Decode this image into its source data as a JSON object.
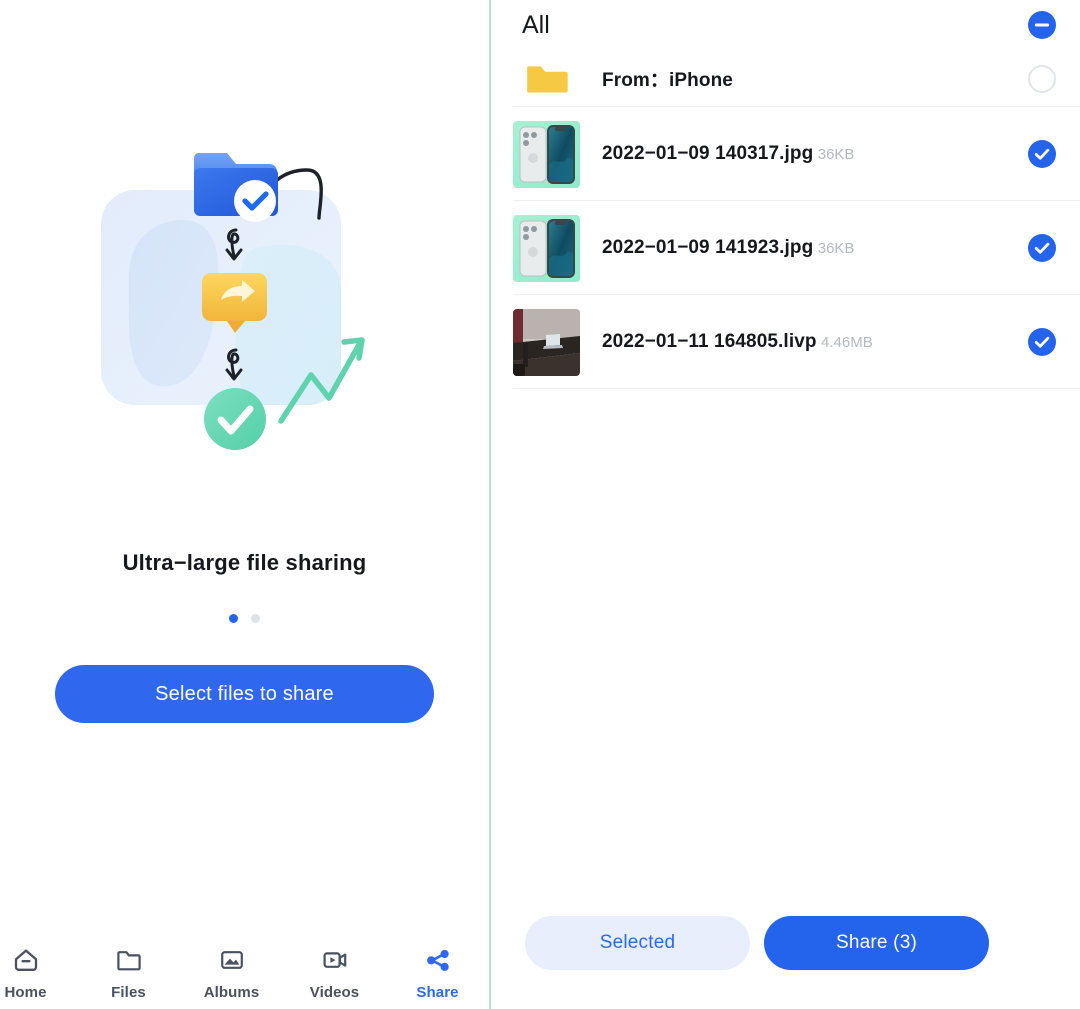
{
  "theme": {
    "accent_blue": "#2463eb",
    "cta_blue": "#2f68ef",
    "soft_blue_bg": "#e9eefc",
    "divider_blue": "#bcd9e8",
    "text_primary": "#16181c",
    "text_muted": "#b3b8c2",
    "nav_inactive": "#4a5160",
    "folder_yellow": "#f5c944"
  },
  "left": {
    "hero": {
      "icon": "ultra-large-file-sharing-illustration",
      "title": "Ultra−large file sharing"
    },
    "carousel": {
      "total": 2,
      "active_index": 0
    },
    "cta_label": "Select files to share",
    "nav": {
      "items": [
        {
          "id": "home",
          "label": "Home",
          "icon": "home-icon",
          "active": false
        },
        {
          "id": "files",
          "label": "Files",
          "icon": "folder-icon",
          "active": false
        },
        {
          "id": "albums",
          "label": "Albums",
          "icon": "image-icon",
          "active": false
        },
        {
          "id": "videos",
          "label": "Videos",
          "icon": "video-icon",
          "active": false
        },
        {
          "id": "share",
          "label": "Share",
          "icon": "share-icon",
          "active": true
        }
      ]
    }
  },
  "right": {
    "header": {
      "title": "All",
      "select_all_state": "indeterminate",
      "select_all_icon": "minus-circle-icon"
    },
    "rows": [
      {
        "type": "folder",
        "icon": "folder-icon",
        "name": "From：iPhone",
        "size": "",
        "checked": false,
        "check_icon": "empty-circle-icon"
      },
      {
        "type": "image",
        "icon": "iphone-photo-thumbnail",
        "name": "2022−01−09 140317.jpg",
        "size": "36KB",
        "checked": true,
        "check_icon": "check-circle-icon"
      },
      {
        "type": "image",
        "icon": "iphone-photo-thumbnail",
        "name": "2022−01−09 141923.jpg",
        "size": "36KB",
        "checked": true,
        "check_icon": "check-circle-icon"
      },
      {
        "type": "livephoto",
        "icon": "desk-laptop-photo-thumbnail",
        "name": "2022−01−11 164805.livp",
        "size": "4.46MB",
        "checked": true,
        "check_icon": "check-circle-icon"
      }
    ],
    "footer": {
      "selected_label": "Selected",
      "share_label": "Share (3)",
      "share_count": 3
    }
  }
}
